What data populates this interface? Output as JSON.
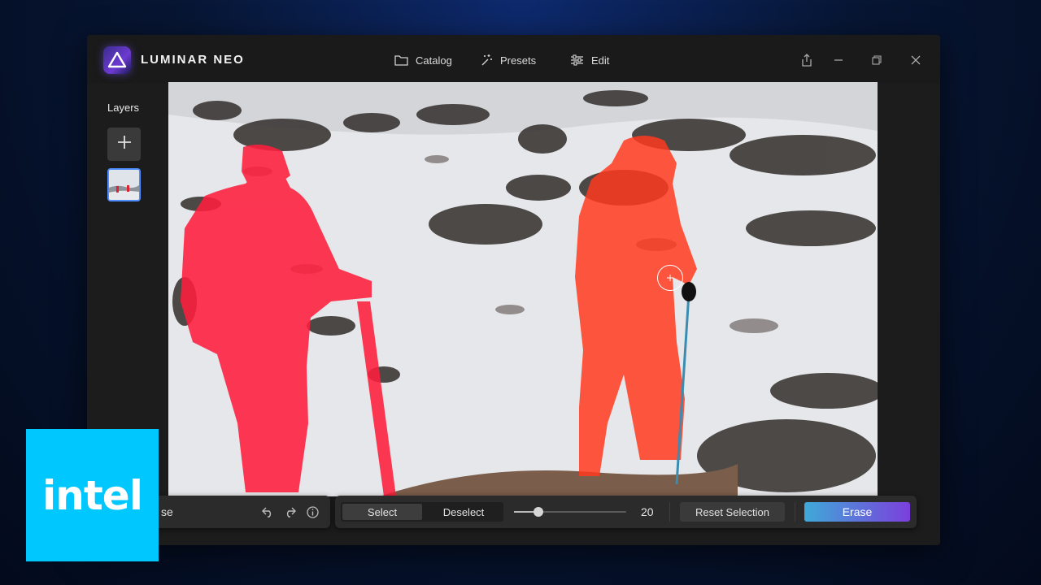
{
  "app": {
    "name": "LUMINAR NEO",
    "accent_color": "#6a3fd6"
  },
  "nav": {
    "items": [
      {
        "label": "Catalog",
        "icon": "folder-icon"
      },
      {
        "label": "Presets",
        "icon": "sparkle-icon"
      },
      {
        "label": "Edit",
        "icon": "sliders-icon"
      }
    ]
  },
  "window_controls": [
    "share-icon",
    "minimize-icon",
    "restore-icon",
    "close-icon"
  ],
  "layers": {
    "title": "Layers",
    "add_icon": "plus-icon"
  },
  "tool": {
    "name_partial": "se",
    "icons": [
      "undo-icon",
      "redo-icon",
      "info-icon"
    ]
  },
  "selection": {
    "select_label": "Select",
    "deselect_label": "Deselect",
    "active_mode": "Select"
  },
  "brush": {
    "size_value": "20",
    "size_fraction": 0.22
  },
  "actions": {
    "reset_label": "Reset Selection",
    "erase_label": "Erase",
    "erase_gradient_start": "#3fa9d8",
    "erase_gradient_end": "#7b3fdc"
  },
  "overlay": {
    "mask_color": "#ff1e3c"
  },
  "brand_badge": {
    "word": "intel",
    "color": "#00c7fd"
  }
}
